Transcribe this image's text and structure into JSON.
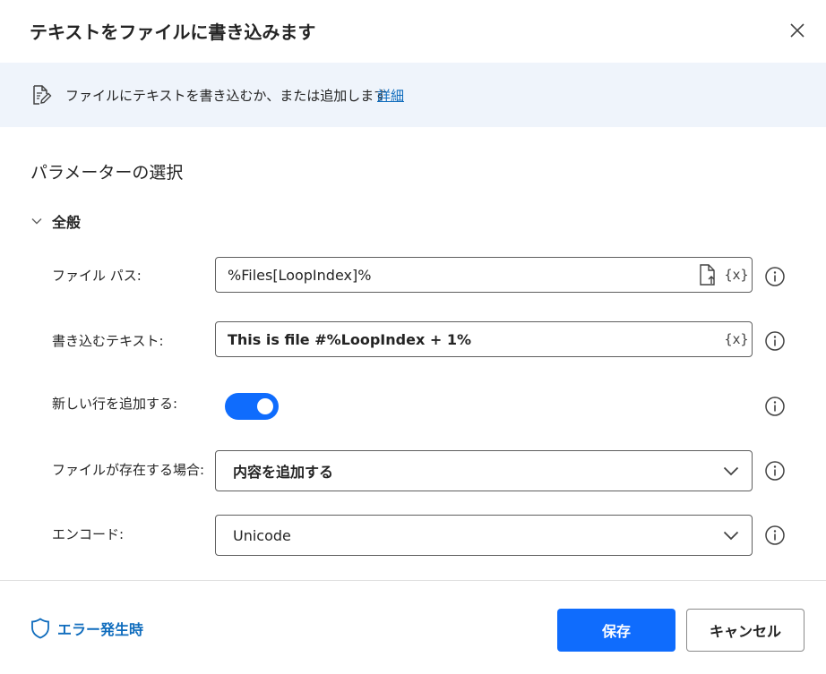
{
  "dialog": {
    "title": "テキストをファイルに書き込みます"
  },
  "banner": {
    "description": "ファイルにテキストを書き込むか、または追加します",
    "link": "詳細"
  },
  "section": {
    "title": "パラメーターの選択",
    "group": "全般"
  },
  "fields": {
    "file_path": {
      "label": "ファイル パス:",
      "value": "%Files[LoopIndex]%",
      "var_icon": "{x}"
    },
    "text": {
      "label": "書き込むテキスト:",
      "value": "This is file #%LoopIndex + 1%",
      "var_icon": "{x}"
    },
    "new_line": {
      "label": "新しい行を追加する:",
      "enabled": true
    },
    "if_exists": {
      "label": "ファイルが存在する場合:",
      "value": "内容を追加する"
    },
    "encoding": {
      "label": "エンコード:",
      "value": "Unicode"
    }
  },
  "footer": {
    "on_error": "エラー発生時",
    "save": "保存",
    "cancel": "キャンセル"
  },
  "colors": {
    "accent": "#0f6cfd",
    "link": "#0f6cbd",
    "banner_bg": "#eff4fb"
  },
  "icons": {
    "close": "close-icon",
    "banner": "document-edit-icon",
    "group": "chevron-down-icon",
    "file_picker": "file-upload-icon",
    "info": "info-icon",
    "dropdown": "chevron-down-icon",
    "on_error": "shield-icon"
  }
}
